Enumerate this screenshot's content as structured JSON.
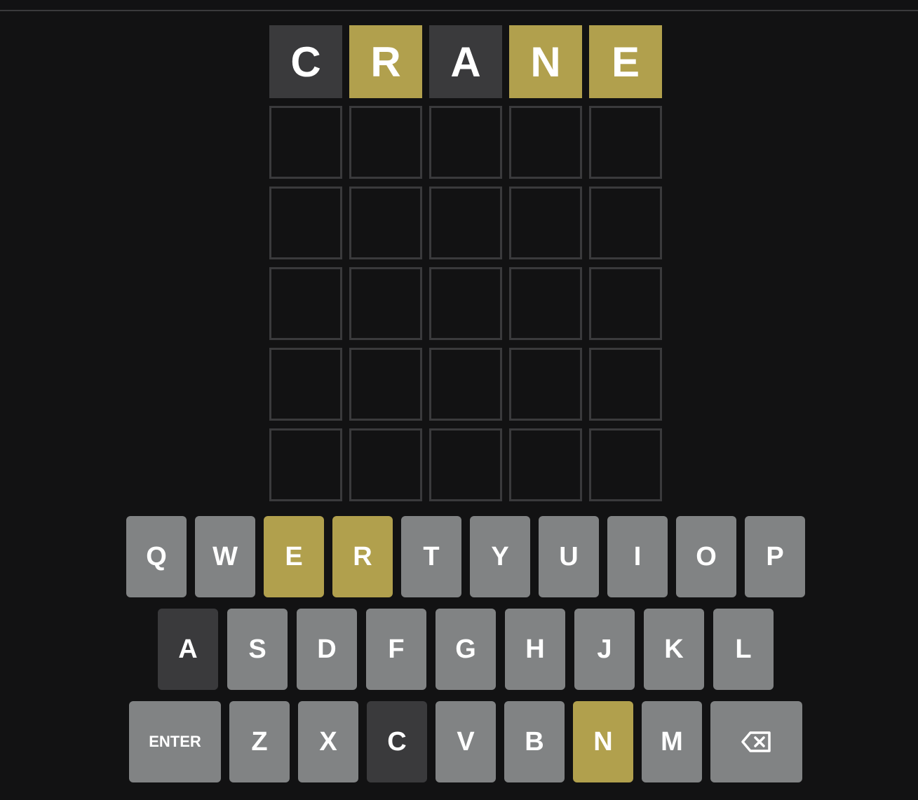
{
  "colors": {
    "background": "#121213",
    "absent": "#3a3a3c",
    "present": "#b1a04d",
    "key_default": "#818384",
    "empty_border": "#3a3a3c",
    "text": "#ffffff"
  },
  "board": {
    "rows": [
      [
        {
          "letter": "C",
          "state": "absent"
        },
        {
          "letter": "R",
          "state": "present"
        },
        {
          "letter": "A",
          "state": "absent"
        },
        {
          "letter": "N",
          "state": "present"
        },
        {
          "letter": "E",
          "state": "present"
        }
      ],
      [
        {
          "letter": "",
          "state": "empty"
        },
        {
          "letter": "",
          "state": "empty"
        },
        {
          "letter": "",
          "state": "empty"
        },
        {
          "letter": "",
          "state": "empty"
        },
        {
          "letter": "",
          "state": "empty"
        }
      ],
      [
        {
          "letter": "",
          "state": "empty"
        },
        {
          "letter": "",
          "state": "empty"
        },
        {
          "letter": "",
          "state": "empty"
        },
        {
          "letter": "",
          "state": "empty"
        },
        {
          "letter": "",
          "state": "empty"
        }
      ],
      [
        {
          "letter": "",
          "state": "empty"
        },
        {
          "letter": "",
          "state": "empty"
        },
        {
          "letter": "",
          "state": "empty"
        },
        {
          "letter": "",
          "state": "empty"
        },
        {
          "letter": "",
          "state": "empty"
        }
      ],
      [
        {
          "letter": "",
          "state": "empty"
        },
        {
          "letter": "",
          "state": "empty"
        },
        {
          "letter": "",
          "state": "empty"
        },
        {
          "letter": "",
          "state": "empty"
        },
        {
          "letter": "",
          "state": "empty"
        }
      ],
      [
        {
          "letter": "",
          "state": "empty"
        },
        {
          "letter": "",
          "state": "empty"
        },
        {
          "letter": "",
          "state": "empty"
        },
        {
          "letter": "",
          "state": "empty"
        },
        {
          "letter": "",
          "state": "empty"
        }
      ]
    ]
  },
  "keyboard": {
    "rows": [
      [
        {
          "label": "Q",
          "state": "default"
        },
        {
          "label": "W",
          "state": "default"
        },
        {
          "label": "E",
          "state": "present"
        },
        {
          "label": "R",
          "state": "present"
        },
        {
          "label": "T",
          "state": "default"
        },
        {
          "label": "Y",
          "state": "default"
        },
        {
          "label": "U",
          "state": "default"
        },
        {
          "label": "I",
          "state": "default"
        },
        {
          "label": "O",
          "state": "default"
        },
        {
          "label": "P",
          "state": "default"
        }
      ],
      [
        {
          "label": "A",
          "state": "absent"
        },
        {
          "label": "S",
          "state": "default"
        },
        {
          "label": "D",
          "state": "default"
        },
        {
          "label": "F",
          "state": "default"
        },
        {
          "label": "G",
          "state": "default"
        },
        {
          "label": "H",
          "state": "default"
        },
        {
          "label": "J",
          "state": "default"
        },
        {
          "label": "K",
          "state": "default"
        },
        {
          "label": "L",
          "state": "default"
        }
      ],
      [
        {
          "label": "ENTER",
          "state": "default",
          "type": "enter"
        },
        {
          "label": "Z",
          "state": "default"
        },
        {
          "label": "X",
          "state": "default"
        },
        {
          "label": "C",
          "state": "absent"
        },
        {
          "label": "V",
          "state": "default"
        },
        {
          "label": "B",
          "state": "default"
        },
        {
          "label": "N",
          "state": "present"
        },
        {
          "label": "M",
          "state": "default"
        },
        {
          "label": "",
          "state": "default",
          "type": "backspace",
          "icon": "backspace-icon"
        }
      ]
    ]
  }
}
